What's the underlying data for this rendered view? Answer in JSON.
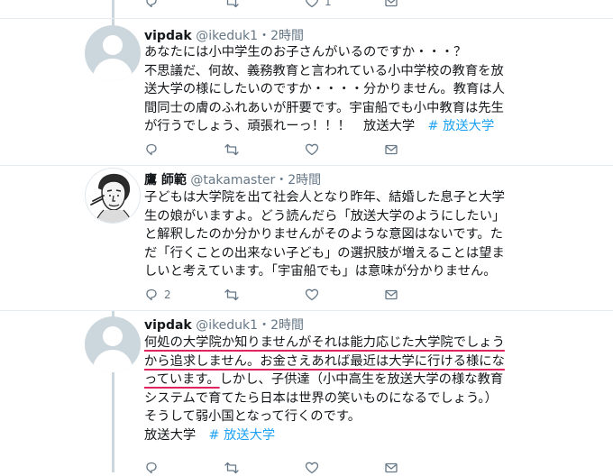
{
  "top_actions": {
    "reply_count": "",
    "retweet_count": "",
    "like_count": "1"
  },
  "tweets": [
    {
      "name": "vipdak",
      "handle": "@ikeduk1",
      "time": "・2時間",
      "lines": [
        "あなたには小中学生のお子さんがいるのですか・・・？",
        "不思議だ、何故、義務教育と言われている小中学校の教育を放",
        "送大学の様にしたいのですか・・・・分かりません。教育は人",
        "間同士の膚のふれあいが肝要です。宇宙船でも小中教育は先生",
        "が行うでしょう、頑張れーっ！！！　放送大学　"
      ],
      "hashtag": "# 放送大学",
      "reply_count": "",
      "retweet_count": "",
      "like_count": ""
    },
    {
      "name": "鷹 師範",
      "handle": "@takamaster",
      "time": "・2時間",
      "lines": [
        "子どもは大学院を出て社会人となり昨年、結婚した息子と大学",
        "生の娘がいますよ。どう読んだら「放送大学のようにしたい」",
        "と解釈したのか分かりませんがそのような意図はないです。た",
        "だ「行くことの出来ない子ども」の選択肢が増えることは望ま",
        "しいと考えています。「宇宙船でも」は意味が分かりません。"
      ],
      "reply_count": "2",
      "retweet_count": "",
      "like_count": ""
    },
    {
      "name": "vipdak",
      "handle": "@ikeduk1",
      "time": "・2時間",
      "lines": [
        "何処の大学院か知りませんがそれは能力応じた大学院でしょう",
        "から追求しません。お金さえあれば最近は大学に行ける様にな",
        "っています。",
        "しかし、子供達（小中高生を放送大学の様な教育",
        "システムで育てたら日本は世界の笑いものになるでしょう。）",
        "そうして弱小国となって行くのです。",
        "放送大学　"
      ],
      "hashtag": "# 放送大学",
      "reply_count": "",
      "retweet_count": "",
      "like_count": ""
    }
  ]
}
